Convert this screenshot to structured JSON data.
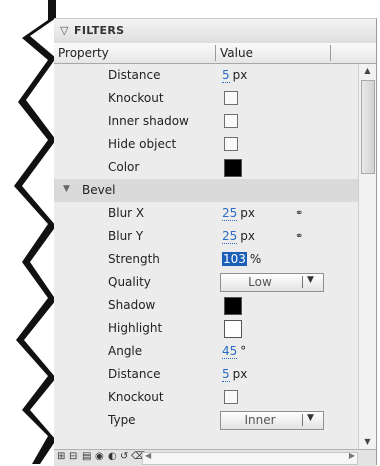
{
  "panel": {
    "title": "FILTERS"
  },
  "header": {
    "property": "Property",
    "value": "Value"
  },
  "rows": {
    "distance1": {
      "label": "Distance",
      "value": "5",
      "unit": "px"
    },
    "knockout1": {
      "label": "Knockout",
      "checked": false
    },
    "inner_shadow": {
      "label": "Inner shadow",
      "checked": false
    },
    "hide_object": {
      "label": "Hide object",
      "checked": false
    },
    "color": {
      "label": "Color",
      "swatch": "#000000"
    },
    "bevel": {
      "label": "Bevel",
      "expanded": true
    },
    "blur_x": {
      "label": "Blur X",
      "value": "25",
      "unit": "px"
    },
    "blur_y": {
      "label": "Blur Y",
      "value": "25",
      "unit": "px"
    },
    "strength": {
      "label": "Strength",
      "value": "103",
      "unit": "%"
    },
    "quality": {
      "label": "Quality",
      "selected": "Low"
    },
    "shadow": {
      "label": "Shadow",
      "swatch": "#000000"
    },
    "highlight": {
      "label": "Highlight",
      "swatch": "#ffffff"
    },
    "angle": {
      "label": "Angle",
      "value": "45",
      "unit": "°"
    },
    "distance2": {
      "label": "Distance",
      "value": "5",
      "unit": "px"
    },
    "knockout2": {
      "label": "Knockout",
      "checked": false
    },
    "type": {
      "label": "Type",
      "selected": "Inner"
    }
  },
  "icons": {
    "panel_toggle": "triangle-down",
    "group_toggle": "triangle-down",
    "link": "chain-link",
    "scroll_up": "arrow-up",
    "scroll_down": "arrow-down",
    "bottom_toolbar": [
      "add-filter",
      "remove-filter",
      "presets",
      "clipboard",
      "enable-toggle",
      "reset",
      "delete"
    ]
  },
  "colors": {
    "panel_bg": "#ececec",
    "group_bg": "#dadada",
    "value_link": "#2a6cc4",
    "selection": "#1b5fb8"
  }
}
